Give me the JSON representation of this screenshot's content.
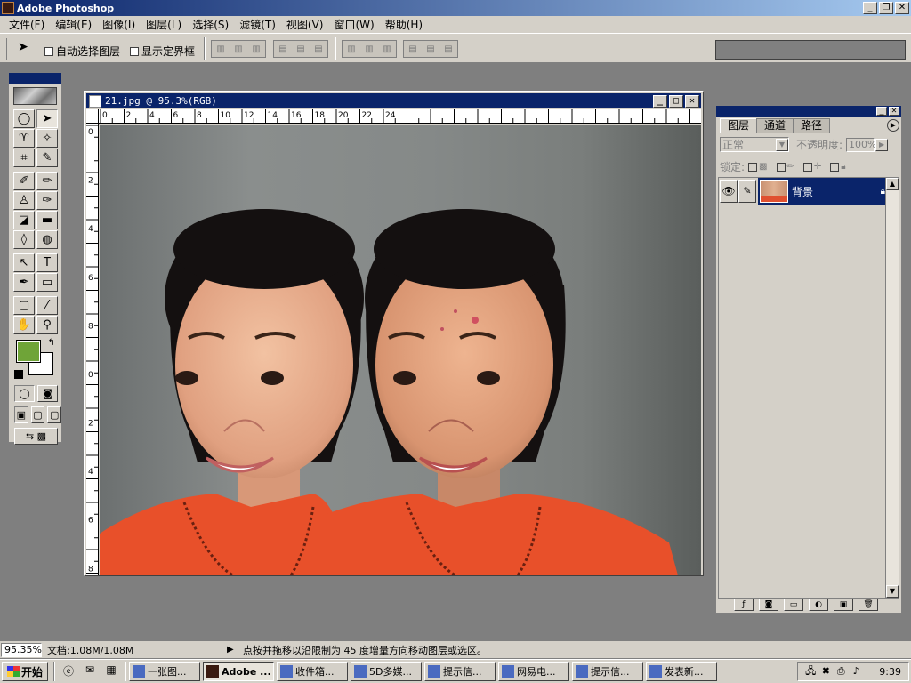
{
  "app": {
    "title": "Adobe Photoshop",
    "window_buttons": [
      "_",
      "❐",
      "✕"
    ]
  },
  "menu": [
    "文件(F)",
    "编辑(E)",
    "图像(I)",
    "图层(L)",
    "选择(S)",
    "滤镜(T)",
    "视图(V)",
    "窗口(W)",
    "帮助(H)"
  ],
  "options": {
    "auto_select_label": "自动选择图层",
    "show_bounds_label": "显示定界框"
  },
  "document": {
    "title": "21.jpg @ 95.3%(RGB)",
    "h_ruler": [
      "0",
      "2",
      "4",
      "6",
      "8",
      "10",
      "12",
      "14",
      "16",
      "18",
      "20",
      "22",
      "24"
    ],
    "v_ruler": [
      "0",
      "2",
      "4",
      "6",
      "8",
      "0",
      "2",
      "4",
      "6",
      "8"
    ]
  },
  "toolbox": {
    "foreground_color": "#6fa438",
    "background_color": "#ffffff"
  },
  "layers_palette": {
    "tabs": [
      "图层",
      "通道",
      "路径"
    ],
    "blend_mode": "正常",
    "opacity_label": "不透明度:",
    "opacity_value": "100%",
    "lock_label": "锁定:",
    "layer_name": "背景"
  },
  "status": {
    "zoom": "95.35%",
    "doc_info": "文档:1.08M/1.08M",
    "hint": "点按并拖移以沿限制为 45 度增量方向移动图层或选区。"
  },
  "taskbar": {
    "start": "开始",
    "tasks": [
      "一张图...",
      "Adobe ...",
      "收件箱...",
      "5D多媒...",
      "提示信...",
      "网易电...",
      "提示信...",
      "发表新..."
    ],
    "clock": "9:39"
  }
}
